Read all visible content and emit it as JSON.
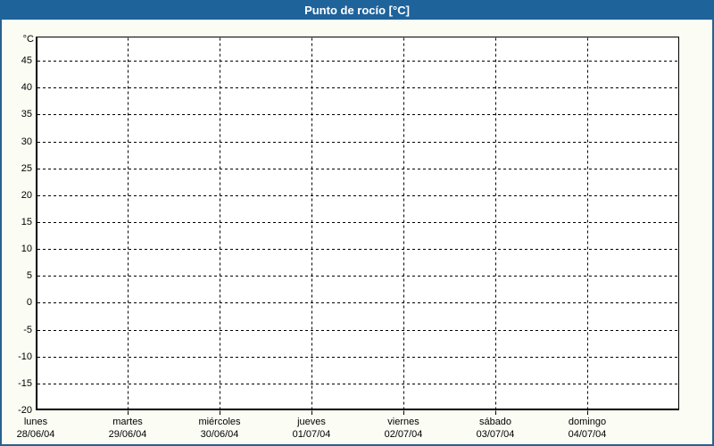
{
  "window": {
    "title": "Punto de rocío [°C]"
  },
  "colors": {
    "title_bar_bg": "#1f639b",
    "title_text": "#ffffff",
    "outer_border": "#29618f",
    "page_bg": "#fbfdf4",
    "plot_bg": "#ffffff",
    "grid": "#000000",
    "axis": "#000000",
    "label_text": "#000000"
  },
  "chart_data": {
    "type": "line",
    "title": "Punto de rocío [°C]",
    "xlabel": "",
    "ylabel": "°C",
    "ylim": [
      -20,
      49.5
    ],
    "y_tick_step": 5,
    "y_ticks": [
      45,
      40,
      35,
      30,
      25,
      20,
      15,
      10,
      5,
      0,
      -5,
      -10,
      -15,
      -20
    ],
    "grid": "dashed",
    "legend_position": "none",
    "x_categories": [
      "lunes",
      "martes",
      "miércoles",
      "jueves",
      "viernes",
      "sábado",
      "domingo"
    ],
    "x_dates": [
      "28/06/04",
      "29/06/04",
      "30/06/04",
      "01/07/04",
      "02/07/04",
      "03/07/04",
      "04/07/04"
    ],
    "series": []
  }
}
